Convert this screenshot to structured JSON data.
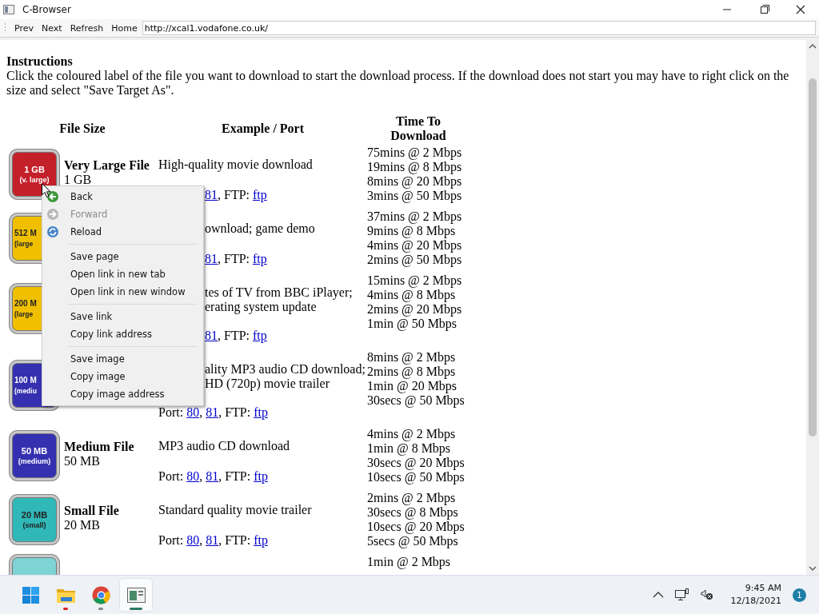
{
  "window": {
    "title": "C-Browser"
  },
  "toolbar": {
    "buttons": [
      "Prev",
      "Next",
      "Refresh",
      "Home"
    ],
    "address": "http://xcal1.vodafone.co.uk/"
  },
  "page": {
    "heading": "Instructions",
    "intro": "Click the coloured label of the file you want to download to start the download process. If the download does not start you may have to right click on the size and select \"Save Target As\".",
    "columns": [
      "File Size",
      "Example / Port",
      "Time To Download"
    ],
    "rows": [
      {
        "badge": [
          "1 GB",
          "(v. large)"
        ],
        "color": "#c4202a",
        "covered": false,
        "name": "Very Large File",
        "size": "1 GB",
        "example": [
          "High-quality movie download"
        ],
        "port": [
          {
            "text": "81",
            "link": true
          },
          {
            "text": ", FTP: ",
            "link": false
          },
          {
            "text": "ftp",
            "link": true
          }
        ],
        "port_covered": true,
        "times": [
          "75mins @ 2 Mbps",
          "19mins @ 8 Mbps",
          "8mins @ 20 Mbps",
          "3mins @ 50 Mbps"
        ]
      },
      {
        "badge": [
          "512 M",
          "(large"
        ],
        "color": "#f0c000",
        "covered": true,
        "example": [
          "ownload; game demo"
        ],
        "port": [
          {
            "text": "81",
            "link": true
          },
          {
            "text": ", FTP: ",
            "link": false
          },
          {
            "text": "ftp",
            "link": true
          }
        ],
        "port_covered": true,
        "times": [
          "37mins @ 2 Mbps",
          "9mins @ 8 Mbps",
          "4mins @ 20 Mbps",
          "2mins @ 50 Mbps"
        ]
      },
      {
        "badge": [
          "200 M",
          "(large"
        ],
        "color": "#f0c000",
        "covered": true,
        "example": [
          "tes of TV from BBC iPlayer;",
          "erating system update"
        ],
        "port": [
          {
            "text": "81",
            "link": true
          },
          {
            "text": ", FTP: ",
            "link": false
          },
          {
            "text": "ftp",
            "link": true
          }
        ],
        "port_covered": true,
        "times": [
          "15mins @ 2 Mbps",
          "4mins @ 8 Mbps",
          "2mins @ 20 Mbps",
          "1min @ 50 Mbps"
        ]
      },
      {
        "badge": [
          "100 M",
          "(mediu"
        ],
        "color": "#3530b0",
        "covered": true,
        "example": [
          "ality MP3 audio CD download;",
          "HD (720p) movie trailer"
        ],
        "port": [
          {
            "text": "Port: ",
            "link": false
          },
          {
            "text": "80",
            "link": true
          },
          {
            "text": ", ",
            "link": false
          },
          {
            "text": "81",
            "link": true
          },
          {
            "text": ", FTP: ",
            "link": false
          },
          {
            "text": "ftp",
            "link": true
          }
        ],
        "port_covered": false,
        "times": [
          "8mins @ 2 Mbps",
          "2mins @ 8 Mbps",
          "1min @ 20 Mbps",
          "30secs @ 50 Mbps"
        ]
      },
      {
        "badge": [
          "50 MB",
          "(medium)"
        ],
        "color": "#3530b0",
        "covered": false,
        "name": "Medium File",
        "size": "50 MB",
        "example": [
          "MP3 audio CD download"
        ],
        "port": [
          {
            "text": "Port: ",
            "link": false
          },
          {
            "text": "80",
            "link": true
          },
          {
            "text": ", ",
            "link": false
          },
          {
            "text": "81",
            "link": true
          },
          {
            "text": ", FTP: ",
            "link": false
          },
          {
            "text": "ftp",
            "link": true
          }
        ],
        "port_covered": false,
        "times": [
          "4mins @ 2 Mbps",
          "1min @ 8 Mbps",
          "30secs @ 20 Mbps",
          "10secs @ 50 Mbps"
        ]
      },
      {
        "badge": [
          "20 MB",
          "(small)"
        ],
        "color": "#30b8b8",
        "covered": false,
        "name": "Small File",
        "size": "20 MB",
        "example": [
          "Standard quality movie trailer"
        ],
        "port": [
          {
            "text": "Port: ",
            "link": false
          },
          {
            "text": "80",
            "link": true
          },
          {
            "text": ", ",
            "link": false
          },
          {
            "text": "81",
            "link": true
          },
          {
            "text": ", FTP: ",
            "link": false
          },
          {
            "text": "ftp",
            "link": true
          }
        ],
        "port_covered": false,
        "times": [
          "2mins @ 2 Mbps",
          "30secs @ 8 Mbps",
          "10secs @ 20 Mbps",
          "5secs @ 50 Mbps"
        ]
      },
      {
        "color": "#7ed4d4",
        "times": [
          "1min @ 2 Mbps"
        ]
      }
    ]
  },
  "context_menu": {
    "groups": [
      [
        {
          "label": "Back",
          "disabled": false
        },
        {
          "label": "Forward",
          "disabled": true
        },
        {
          "label": "Reload",
          "disabled": false
        }
      ],
      [
        {
          "label": "Save page",
          "disabled": false
        },
        {
          "label": "Open link in new tab",
          "disabled": false
        },
        {
          "label": "Open link in new window",
          "disabled": false
        }
      ],
      [
        {
          "label": "Save link",
          "disabled": false
        },
        {
          "label": "Copy link address",
          "disabled": false
        }
      ],
      [
        {
          "label": "Save image",
          "disabled": false
        },
        {
          "label": "Copy image",
          "disabled": false
        },
        {
          "label": "Copy image address",
          "disabled": false
        }
      ]
    ]
  },
  "taskbar": {
    "apps": [
      {
        "kind": "start",
        "running": false,
        "attention": false,
        "selected": false
      },
      {
        "kind": "folder",
        "running": true,
        "attention": true,
        "selected": false
      },
      {
        "kind": "chrome",
        "running": true,
        "attention": false,
        "selected": false
      },
      {
        "kind": "browser",
        "running": true,
        "attention": false,
        "selected": true
      }
    ],
    "time": "9:45 AM",
    "date": "12/18/2021",
    "notifications": "1"
  }
}
